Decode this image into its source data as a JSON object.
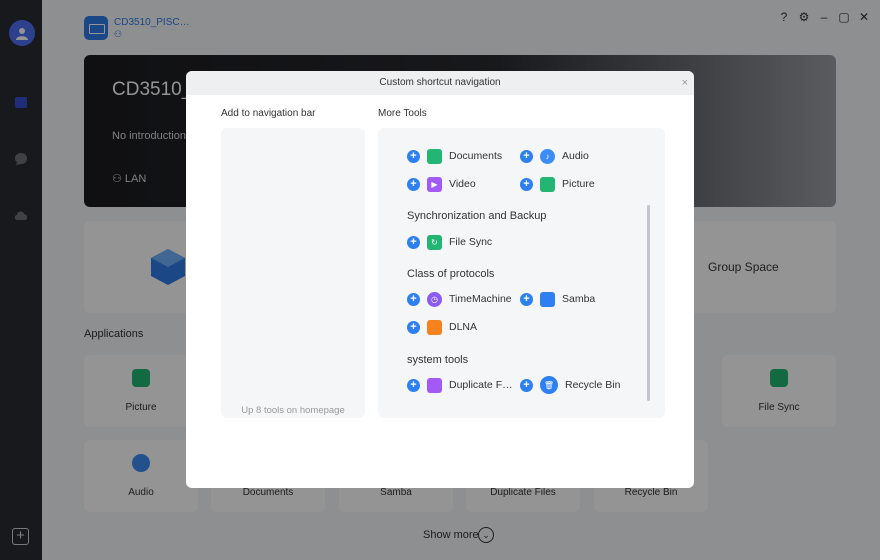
{
  "rail": {
    "icons": [
      "user-icon",
      "app-cube-icon",
      "chat-icon",
      "cloud-icon"
    ],
    "add": "+"
  },
  "device": {
    "name": "CD3510_PISC…",
    "sub": "⚇"
  },
  "window": {
    "help": "?",
    "settings": "⚙",
    "minimize": "–",
    "maximize": "▢",
    "close": "✕"
  },
  "banner": {
    "title": "CD3510_",
    "intro": "No introduction",
    "lan": "LAN"
  },
  "group_space": "Group Space",
  "applications_label": "Applications",
  "apps": [
    {
      "label": "Picture"
    },
    {
      "label": "File Sync"
    },
    {
      "label": "Audio"
    },
    {
      "label": "Documents"
    },
    {
      "label": "Samba"
    },
    {
      "label": "Duplicate Files"
    },
    {
      "label": "Recycle Bin"
    }
  ],
  "show_more": "Show more",
  "modal": {
    "title": "Custom shortcut navigation",
    "close": "×",
    "left_title": "Add to navigation bar",
    "left_hint": "Up 8 tools on homepage",
    "right_title": "More Tools",
    "sections": [
      {
        "title": "Synchronization and Backup"
      },
      {
        "title": "Class of protocols"
      },
      {
        "title": "system tools"
      }
    ],
    "tools": [
      {
        "label": "Documents",
        "color": "#22b573"
      },
      {
        "label": "Audio",
        "color": "#3b8cf5"
      },
      {
        "label": "Video",
        "color": "#a259f5"
      },
      {
        "label": "Picture",
        "color": "#22b573"
      },
      {
        "label": "File Sync",
        "color": "#22b573"
      },
      {
        "label": "TimeMachine",
        "color": "#8a5cf0"
      },
      {
        "label": "Samba",
        "color": "#2d7ff2"
      },
      {
        "label": "DLNA",
        "color": "#f5821f"
      },
      {
        "label": "Duplicate F…",
        "color": "#a259f5"
      },
      {
        "label": "Recycle Bin",
        "color": "#2d7ff2"
      }
    ],
    "plus": "+"
  }
}
